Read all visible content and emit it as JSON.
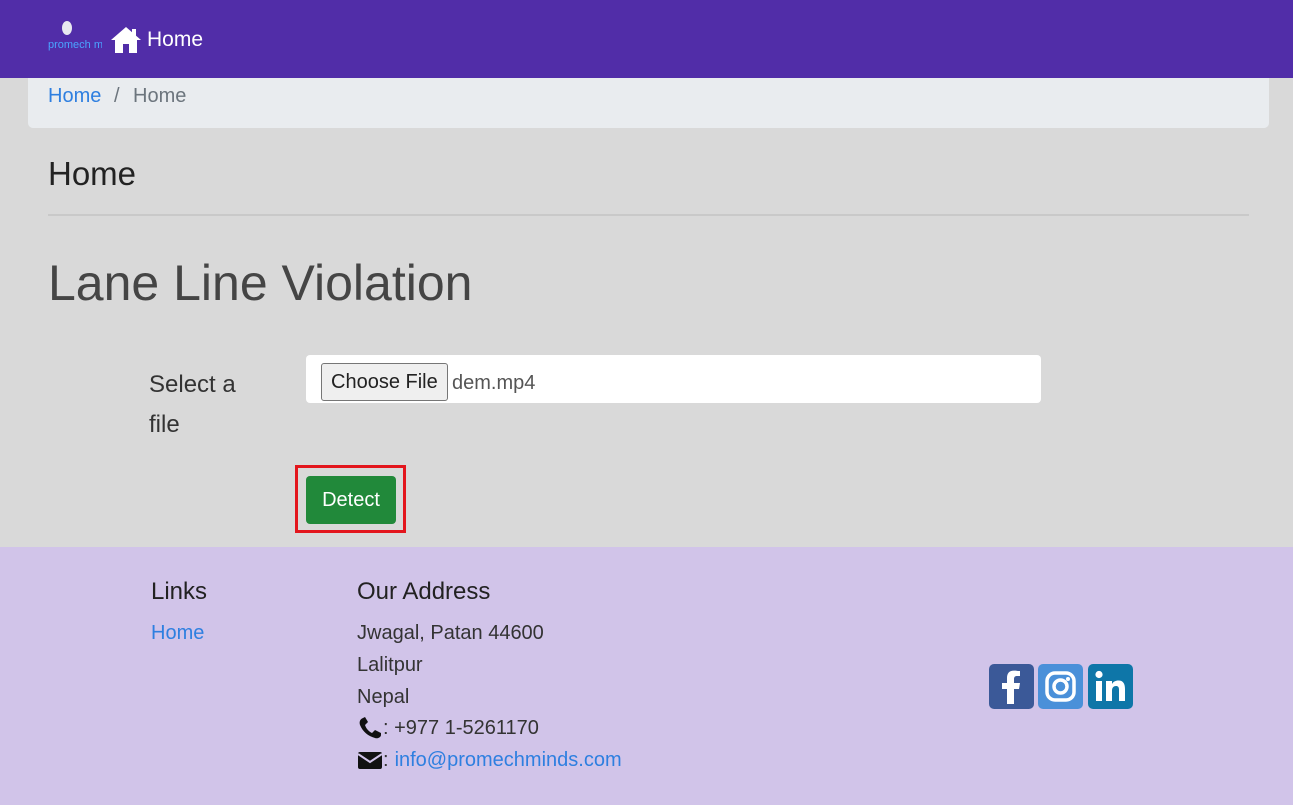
{
  "navbar": {
    "logo_text": "promech minds",
    "home_label": "Home",
    "icons": {
      "home": "home-icon"
    },
    "background": "#512da8"
  },
  "breadcrumb": {
    "link": "Home",
    "separator": "/",
    "active": "Home"
  },
  "page": {
    "heading": "Home",
    "title": "Lane Line Violation"
  },
  "form": {
    "file_label": "Select a file",
    "choose_button": "Choose File",
    "file_name": "dem.mp4",
    "detect_button": "Detect",
    "detect_color": "#21893a"
  },
  "footer": {
    "links_title": "Links",
    "links": [
      "Home"
    ],
    "address_title": "Our Address",
    "address_lines": [
      "Jwagal, Patan 44600",
      "Lalitpur",
      "Nepal"
    ],
    "phone": ": +977 1-5261170",
    "email_prefix": ":",
    "email": "info@promechminds.com",
    "social": [
      "facebook-icon",
      "instagram-icon",
      "linkedin-icon"
    ],
    "background": "#d1c4e9"
  }
}
